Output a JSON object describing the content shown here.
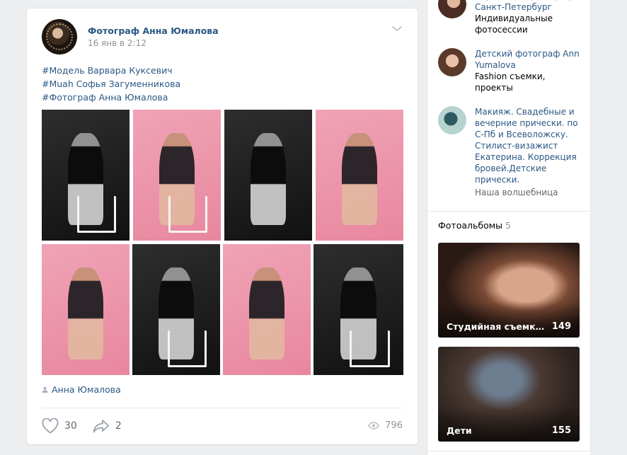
{
  "post": {
    "author": "Фотограф Анна Юмалова",
    "date": "16 янв в 2:12",
    "tags": [
      "#Модель Варвара Куксевич",
      "#Muah Софья Загуменникова",
      "#Фотограф Анна Юмалова"
    ],
    "photos": [
      {
        "tone": "dark"
      },
      {
        "tone": "pink"
      },
      {
        "tone": "dark"
      },
      {
        "tone": "pink"
      },
      {
        "tone": "pink"
      },
      {
        "tone": "dark"
      },
      {
        "tone": "pink"
      },
      {
        "tone": "dark"
      }
    ],
    "credit": "Анна Юмалова",
    "likes": "30",
    "shares": "2",
    "views": "796"
  },
  "contacts": [
    {
      "name": "Студийный фотограф Санкт-Петербург",
      "desc": "Индивидуальные фотосессии",
      "note": ""
    },
    {
      "name": "Детский фотограф Ann Yumalova",
      "desc": "Fashion съемки, проекты",
      "note": ""
    },
    {
      "name": "Макияж. Свадебные и вечерние прически. по С-Пб и Всеволожску. Стилист-визажист Екатерина. Коррекция бровей.Детские прически.",
      "desc": "",
      "note": "Наша волшебница"
    }
  ],
  "albums": {
    "title": "Фотоальбомы",
    "count": "5",
    "items": [
      {
        "title": "Студийная съемка, ...",
        "count": "149"
      },
      {
        "title": "Дети",
        "count": "155"
      }
    ]
  },
  "colors": {
    "link": "#2a5885",
    "bg": "#edeef0",
    "pink": "#ec93a9"
  }
}
